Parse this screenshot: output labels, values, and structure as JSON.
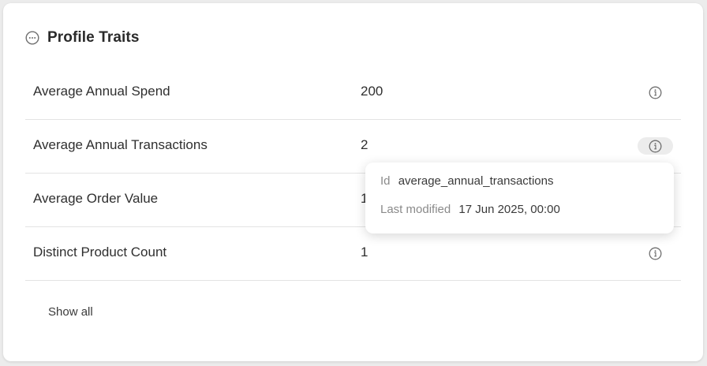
{
  "panel": {
    "title": "Profile Traits",
    "header_icon": "more-horizontal-circle-icon"
  },
  "traits": [
    {
      "name": "Average Annual Spend",
      "value": "200"
    },
    {
      "name": "Average Annual Transactions",
      "value": "2"
    },
    {
      "name": "Average Order Value",
      "value": "1"
    },
    {
      "name": "Distinct Product Count",
      "value": "1"
    }
  ],
  "show_all_label": "Show all",
  "tooltip": {
    "id_label": "Id",
    "id_value": "average_annual_transactions",
    "modified_label": "Last modified",
    "modified_value": "17 Jun 2025, 00:00"
  },
  "colors": {
    "icon": "#6f6f6f",
    "divider": "#e3e3e3",
    "active_info_bg": "#ececec"
  }
}
